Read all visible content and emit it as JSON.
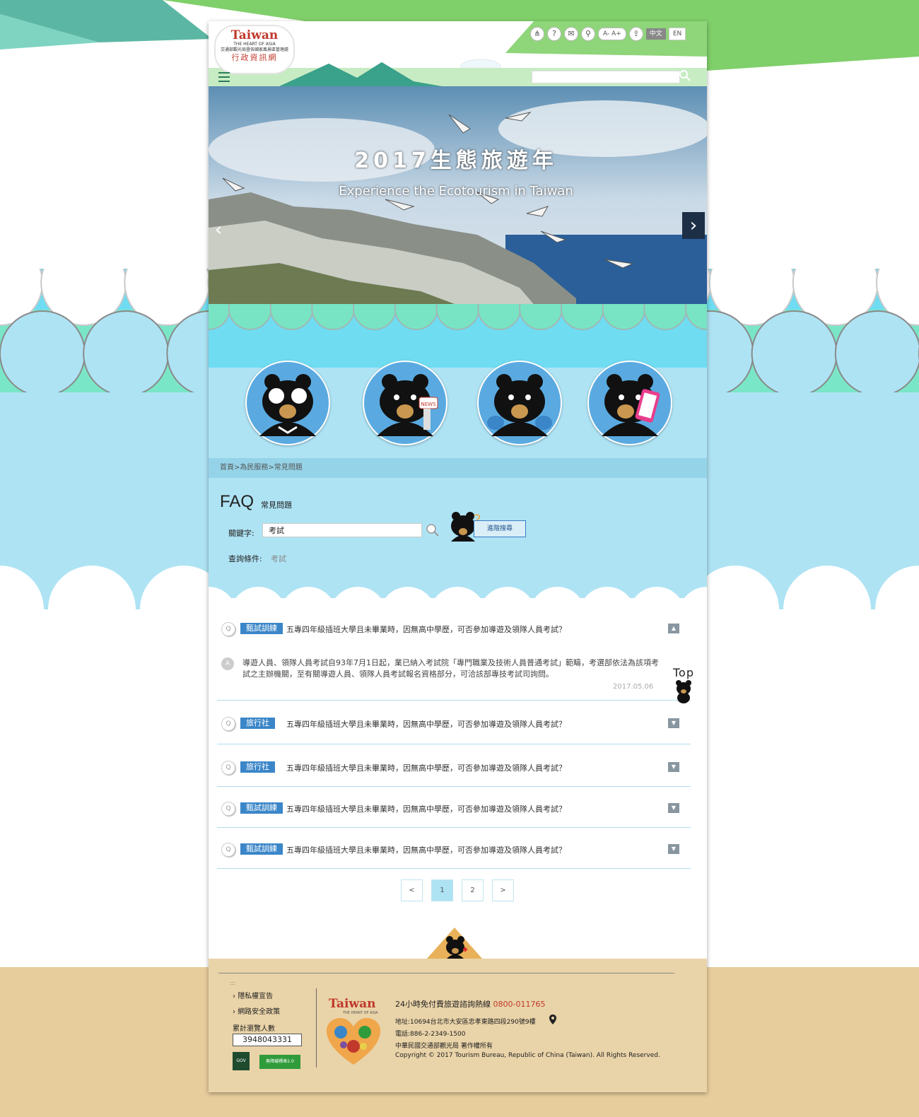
{
  "header": {
    "logo_brand": "Taiwan",
    "logo_tagline": "THE HEART OF ASIA",
    "logo_org": "交通部觀光局暨各國家風景區管理處",
    "logo_site": "行政資訊網",
    "toolbar": {
      "font_small": "A-",
      "font_large": "A+",
      "lang_zh": "中文",
      "lang_en": "EN"
    },
    "search_placeholder": ""
  },
  "hero": {
    "title": "2017生態旅遊年",
    "subtitle": "Experience the Ecotourism in Taiwan"
  },
  "breadcrumb": "首頁>為民服務>常見問題",
  "faq": {
    "title": "FAQ",
    "subtitle": "常見問題",
    "keyword_label": "關鍵字:",
    "keyword_value": "考試",
    "advanced_search": "進階搜尋",
    "condition_label": "查詢條件:",
    "condition_value": "考試",
    "items": [
      {
        "tag": "甄試訓練",
        "question": "五專四年級插班大學且未畢業時，因無高中學歷，可否參加導遊及領隊人員考試？",
        "expanded": true,
        "answer": "導遊人員、領隊人員考試自93年7月1日起，業已納入考試院「專門職業及技術人員普通考試」範疇，考選部依法為該項考試之主辦機關，至有關導遊人員、領隊人員考試報名資格部分，可洽該部專技考試司詢問。",
        "date": "2017.05.06"
      },
      {
        "tag": "旅行社",
        "question": "五專四年級插班大學且未畢業時，因無高中學歷，可否參加導遊及領隊人員考試？",
        "expanded": false
      },
      {
        "tag": "旅行社",
        "question": "五專四年級插班大學且未畢業時，因無高中學歷，可否參加導遊及領隊人員考試？",
        "expanded": false
      },
      {
        "tag": "甄試訓練",
        "question": "五專四年級插班大學且未畢業時，因無高中學歷，可否參加導遊及領隊人員考試？",
        "expanded": false
      },
      {
        "tag": "甄試訓練",
        "question": "五專四年級插班大學且未畢業時，因無高中學歷，可否參加導遊及領隊人員考試？",
        "expanded": false
      }
    ],
    "q_marker": "Q",
    "a_marker": "A",
    "top_label": "Top"
  },
  "pagination": {
    "prev": "<",
    "pages": [
      "1",
      "2"
    ],
    "current": "1",
    "next": ">"
  },
  "footer": {
    "links": [
      "隱私權宣告",
      "網路安全政策"
    ],
    "visitor_label": "累計瀏覽人數",
    "visitor_count": "3948043331",
    "gov_badge": "GOV",
    "access_badge": "無障礙標章2.0",
    "logo_brand": "Taiwan",
    "logo_tagline": "THE HEART OF ASIA",
    "hotline_label": "24小時免付費旅遊諮詢熱線",
    "hotline_number": "0800-011765",
    "address": "地址:10694台北市大安區忠孝東路四段290號9樓",
    "phone": "電話:886-2-2349-1500",
    "copyright_zh": "中華民國交通部觀光局 著作權所有",
    "copyright_en": "Copyright © 2017 Tourism Bureau, Republic of China (Taiwan). All Rights Reserved."
  },
  "colors": {
    "accent_blue": "#3a86c8",
    "sky": "#aee3f4",
    "mint": "#79e4c3",
    "sand": "#e8cd9c",
    "hotline_red": "#c0392b"
  }
}
